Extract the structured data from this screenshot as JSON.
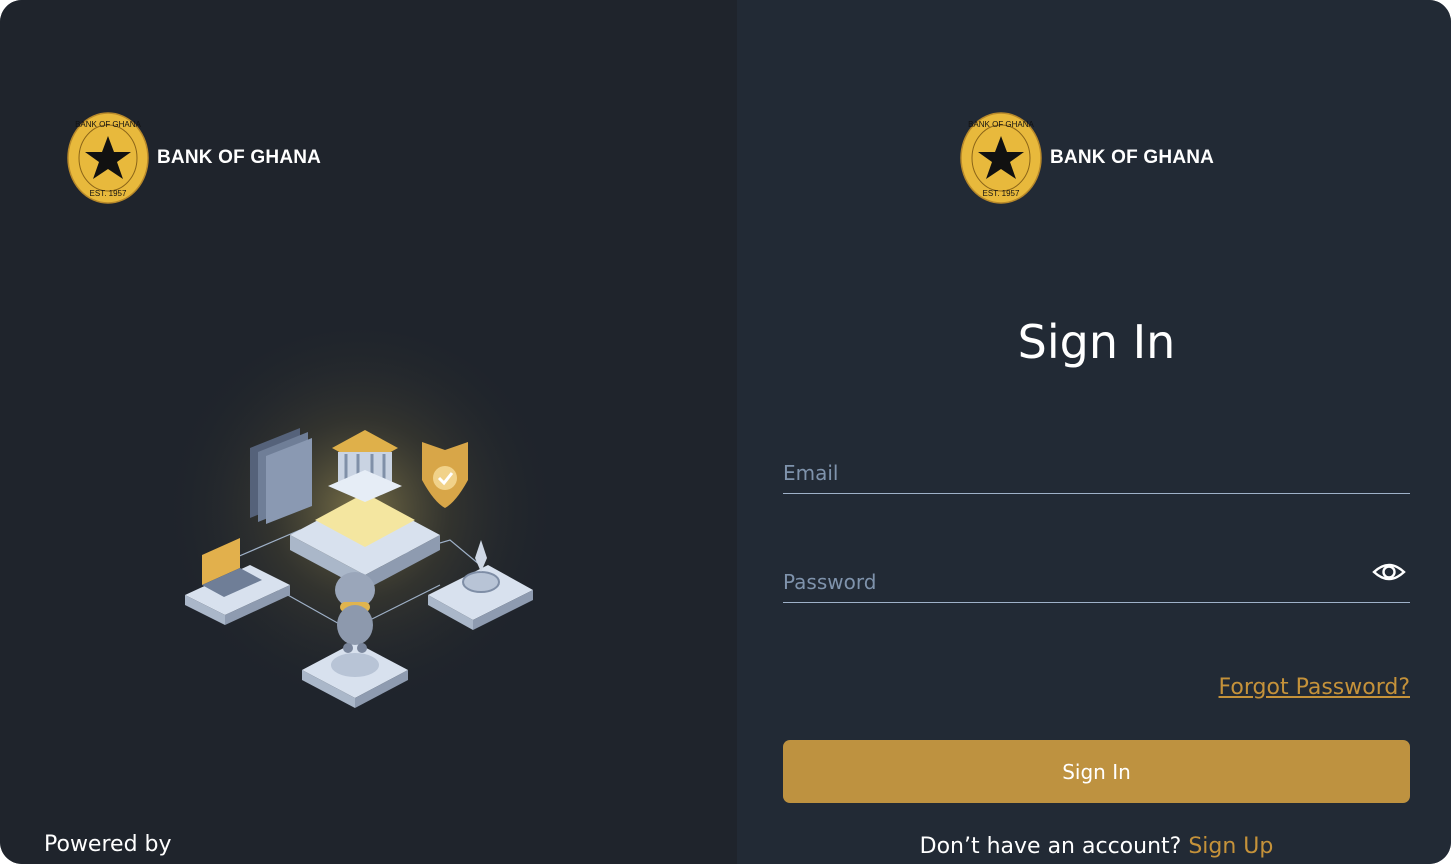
{
  "brand": {
    "name": "BANK OF GHANA",
    "seal_top_text": "BANK OF GHANA",
    "seal_bottom_text": "EST. 1957",
    "seal_color": "#e8b93c"
  },
  "left_panel": {
    "powered_by": "Powered by"
  },
  "form": {
    "title": "Sign In",
    "email_placeholder": "Email",
    "email_value": "",
    "password_placeholder": "Password",
    "password_value": "",
    "show_password_icon": "eye-icon",
    "forgot_password": "Forgot Password?",
    "submit_label": "Sign In",
    "no_account_text": "Don’t have an account?",
    "signup_label": "Sign Up"
  },
  "colors": {
    "accent": "#c5923a",
    "button": "#be9240",
    "left_bg": "#1f242c",
    "right_bg": "#222a35"
  }
}
